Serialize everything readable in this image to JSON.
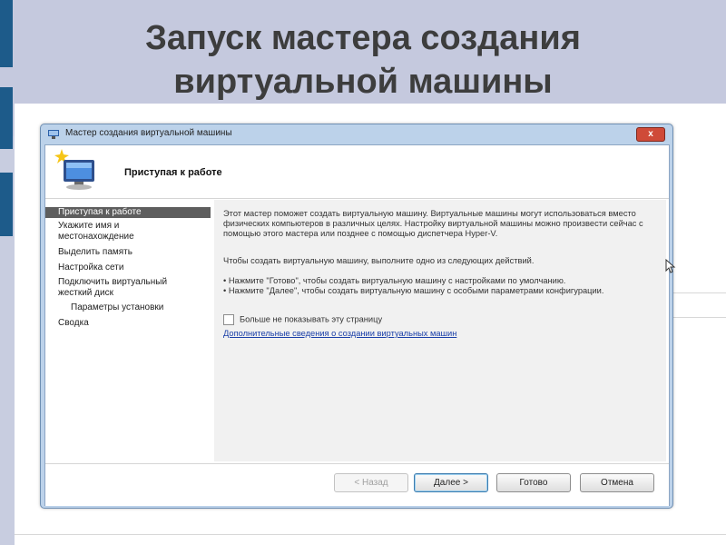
{
  "slide": {
    "title_line1": "Запуск мастера создания",
    "title_line2": "виртуальной машины"
  },
  "window": {
    "title": "Мастер создания виртуальной машины",
    "close_label": "x",
    "header_title": "Приступая к работе"
  },
  "nav": {
    "items": [
      {
        "label": "Приступая к работе",
        "active": true
      },
      {
        "label": "Укажите имя и"
      },
      {
        "label": "местонахождение"
      },
      {
        "label": "Выделить память"
      },
      {
        "label": "Настройка сети"
      },
      {
        "label": "Подключить виртуальный"
      },
      {
        "label": "жесткий диск"
      },
      {
        "label": "Параметры установки"
      },
      {
        "label": "Сводка"
      }
    ]
  },
  "content": {
    "intro": "Этот мастер поможет создать виртуальную машину. Виртуальные машины могут использоваться вместо физических компьютеров в различных целях. Настройку виртуальной машины можно произвести сейчас с помощью этого мастера или позднее с помощью диспетчера Hyper-V.",
    "choose": "Чтобы создать виртуальную машину, выполните одно из следующих действий.",
    "bullet1": "• Нажмите \"Готово\", чтобы создать виртуальную машину с настройками по умолчанию.",
    "bullet2": "• Нажмите \"Далее\", чтобы создать виртуальную машину с особыми параметрами конфигурации.",
    "checkbox_label": "Больше не показывать эту страницу",
    "checkbox_checked": false,
    "link": "Дополнительные сведения о создании виртуальных машин"
  },
  "buttons": {
    "back": "< Назад",
    "next": "Далее >",
    "finish": "Готово",
    "cancel": "Отмена"
  },
  "colors": {
    "slide_bg": "#c5c9de",
    "accent_tab": "#1d5b8a",
    "window_frame": "#bcd2ea",
    "nav_active": "#5e5e5e",
    "link": "#1a3fa8",
    "close": "#cf4a38"
  }
}
